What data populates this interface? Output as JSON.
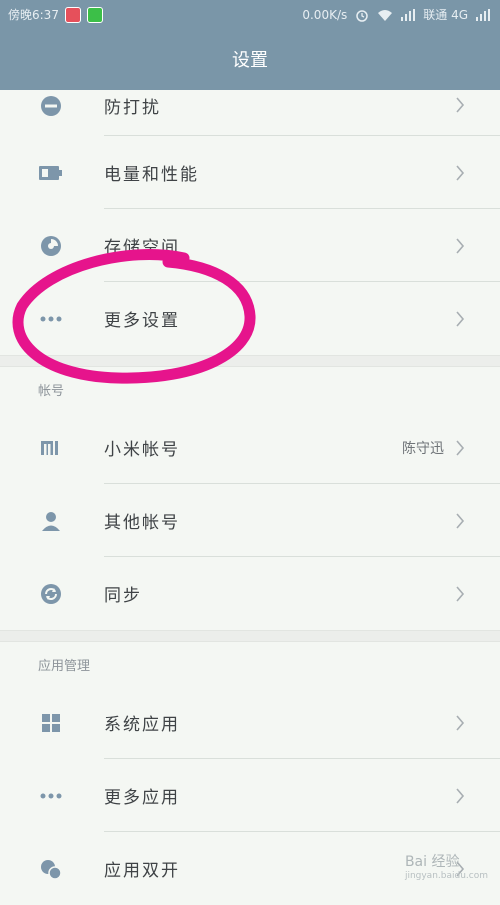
{
  "status_bar": {
    "time": "傍晚6:37",
    "network_speed": "0.00K/s",
    "carrier": "联通 4G"
  },
  "header": {
    "title": "设置"
  },
  "sections": {
    "general": {
      "items": [
        {
          "label": "防打扰",
          "icon": "do-not-disturb-icon"
        },
        {
          "label": "电量和性能",
          "icon": "battery-icon"
        },
        {
          "label": "存储空间",
          "icon": "storage-pie-icon"
        },
        {
          "label": "更多设置",
          "icon": "more-dots-icon"
        }
      ]
    },
    "accounts": {
      "header": "帐号",
      "items": [
        {
          "label": "小米帐号",
          "value": "陈守迅",
          "icon": "mi-logo-icon"
        },
        {
          "label": "其他帐号",
          "icon": "person-icon"
        },
        {
          "label": "同步",
          "icon": "sync-icon"
        }
      ]
    },
    "apps": {
      "header": "应用管理",
      "items": [
        {
          "label": "系统应用",
          "icon": "grid-apps-icon"
        },
        {
          "label": "更多应用",
          "icon": "more-dots-icon"
        },
        {
          "label": "应用双开",
          "icon": "dual-apps-icon"
        }
      ]
    }
  },
  "colors": {
    "header_bg": "#7a96a8",
    "highlight": "#e6148c",
    "icon": "#7d96aa"
  },
  "watermark": {
    "text": "Bai 经验",
    "url_text": "jingyan.baidu.com"
  }
}
